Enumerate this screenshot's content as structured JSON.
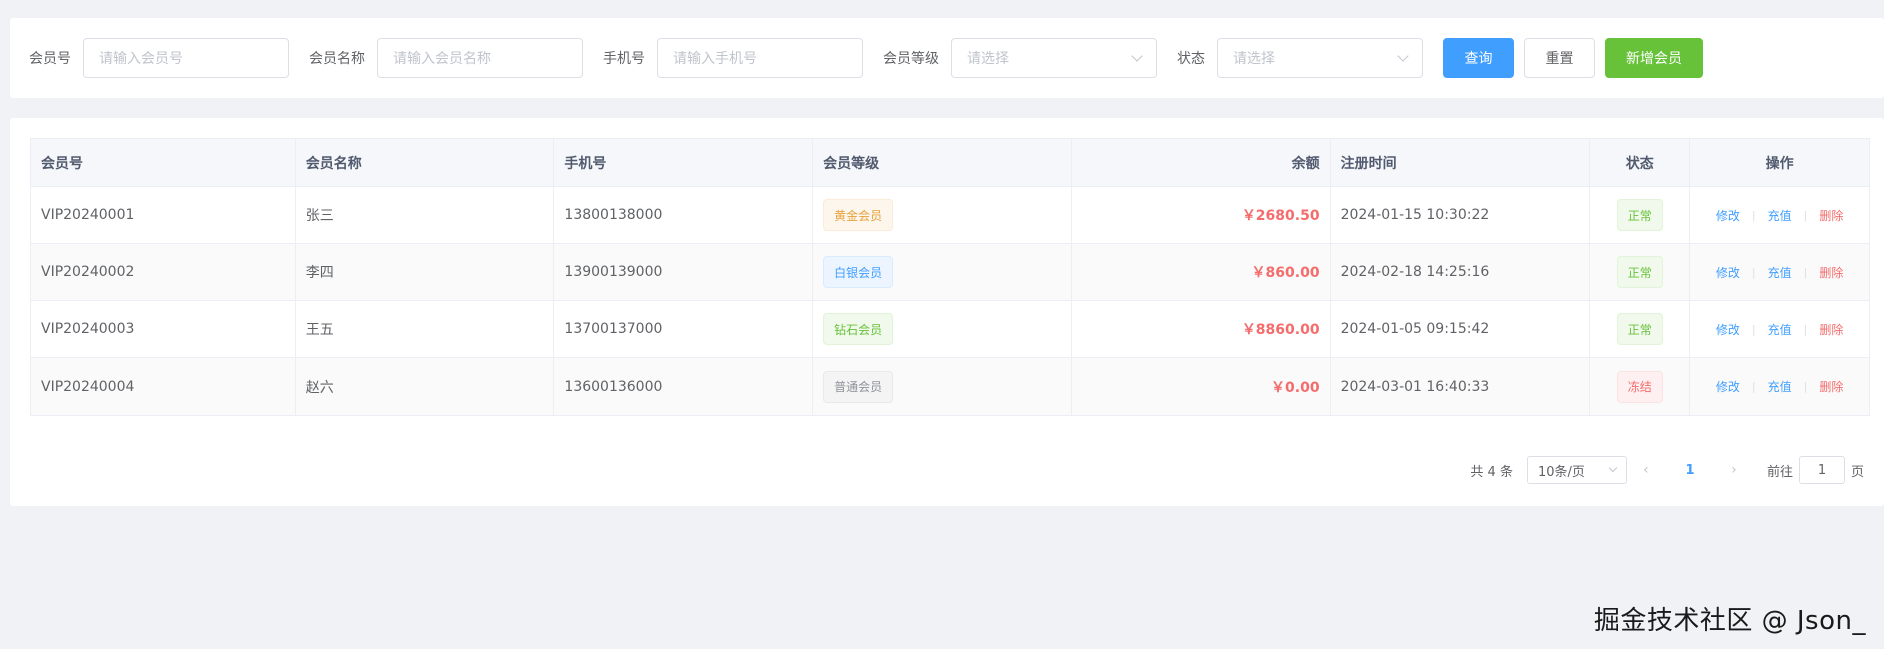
{
  "search": {
    "fields": [
      {
        "label": "会员号",
        "placeholder": "请输入会员号"
      },
      {
        "label": "会员名称",
        "placeholder": "请输入会员名称"
      },
      {
        "label": "手机号",
        "placeholder": "请输入手机号"
      },
      {
        "label": "会员等级",
        "placeholder": "请选择"
      },
      {
        "label": "状态",
        "placeholder": "请选择"
      }
    ],
    "query_label": "查询",
    "reset_label": "重置",
    "add_label": "新增会员"
  },
  "table": {
    "headers": [
      "会员号",
      "会员名称",
      "手机号",
      "会员等级",
      "余额",
      "注册时间",
      "状态",
      "操作"
    ],
    "rows": [
      {
        "id": "VIP20240001",
        "name": "张三",
        "phone": "13800138000",
        "level": "黄金会员",
        "balance": "￥2680.50",
        "time": "2024-01-15 10:30:22",
        "status": "正常"
      },
      {
        "id": "VIP20240002",
        "name": "李四",
        "phone": "13900139000",
        "level": "白银会员",
        "balance": "￥860.00",
        "time": "2024-02-18 14:25:16",
        "status": "正常"
      },
      {
        "id": "VIP20240003",
        "name": "王五",
        "phone": "13700137000",
        "level": "钻石会员",
        "balance": "￥8860.00",
        "time": "2024-01-05 09:15:42",
        "status": "正常"
      },
      {
        "id": "VIP20240004",
        "name": "赵六",
        "phone": "13600136000",
        "level": "普通会员",
        "balance": "￥0.00",
        "time": "2024-03-01 16:40:33",
        "status": "冻结"
      }
    ],
    "ops": {
      "edit": "修改",
      "recharge": "充值",
      "delete": "删除",
      "sep": "|"
    }
  },
  "pager": {
    "total": "共 4 条",
    "size": "10条/页",
    "current": "1",
    "goto_prefix": "前往",
    "goto_value": "1",
    "goto_suffix": "页"
  },
  "watermark": "掘金技术社区 @ Json_",
  "colors": {
    "primary": "#409eff",
    "success": "#67c23a",
    "danger": "#f56c6c",
    "warning": "#e6a23c"
  }
}
